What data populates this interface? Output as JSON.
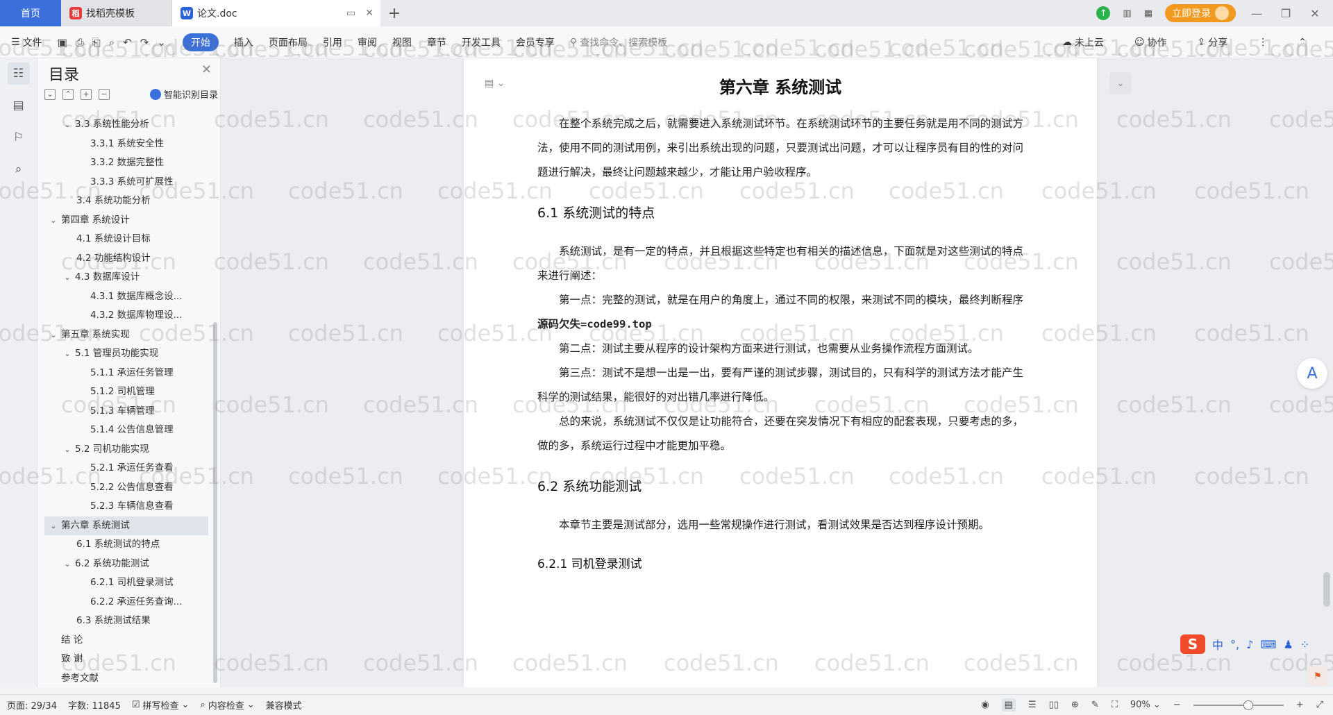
{
  "titlebar": {
    "home_tab": "首页",
    "tabs": [
      {
        "label": "找稻壳模板",
        "icon": "daoke-icon"
      },
      {
        "label": "论文.doc",
        "icon": "wps-writer-icon"
      }
    ],
    "login_label": "立即登录"
  },
  "ribbon": {
    "file_label": "文件",
    "menu": [
      "开始",
      "插入",
      "页面布局",
      "引用",
      "审阅",
      "视图",
      "章节",
      "开发工具",
      "会员专享"
    ],
    "search_placeholder": "查找命令、搜索模板",
    "right": [
      "未上云",
      "协作",
      "分享"
    ]
  },
  "toc": {
    "title": "目录",
    "smart_label": "智能识别目录",
    "items": [
      {
        "label": "3.3 系统性能分析",
        "level": 2,
        "expanded": true
      },
      {
        "label": "3.3.1 系统安全性",
        "level": 3
      },
      {
        "label": "3.3.2 数据完整性",
        "level": 3
      },
      {
        "label": "3.3.3 系统可扩展性",
        "level": 3
      },
      {
        "label": "3.4 系统功能分析",
        "level": 2
      },
      {
        "label": "第四章  系统设计",
        "level": 1,
        "expanded": true
      },
      {
        "label": "4.1  系统设计目标",
        "level": 2
      },
      {
        "label": "4.2 功能结构设计",
        "level": 2
      },
      {
        "label": "4.3 数据库设计",
        "level": 2,
        "expanded": true
      },
      {
        "label": "4.3.1  数据库概念设...",
        "level": 3
      },
      {
        "label": "4.3.2  数据库物理设...",
        "level": 3
      },
      {
        "label": "第五章  系统实现",
        "level": 1,
        "expanded": true
      },
      {
        "label": "5.1 管理员功能实现",
        "level": 2,
        "expanded": true
      },
      {
        "label": "5.1.1  承运任务管理",
        "level": 3
      },
      {
        "label": "5.1.2  司机管理",
        "level": 3
      },
      {
        "label": "5.1.3  车辆管理",
        "level": 3
      },
      {
        "label": "5.1.4  公告信息管理",
        "level": 3
      },
      {
        "label": "5.2 司机功能实现",
        "level": 2,
        "expanded": true
      },
      {
        "label": "5.2.1  承运任务查看",
        "level": 3
      },
      {
        "label": "5.2.2  公告信息查看",
        "level": 3
      },
      {
        "label": "5.2.3  车辆信息查看",
        "level": 3
      },
      {
        "label": "第六章  系统测试",
        "level": 1,
        "expanded": true,
        "active": true
      },
      {
        "label": "6.1 系统测试的特点",
        "level": 2
      },
      {
        "label": "6.2  系统功能测试",
        "level": 2,
        "expanded": true
      },
      {
        "label": "6.2.1  司机登录测试",
        "level": 3
      },
      {
        "label": "6.2.2  承运任务查询...",
        "level": 3
      },
      {
        "label": "6.3  系统测试结果",
        "level": 2
      },
      {
        "label": "结    论",
        "level": 1
      },
      {
        "label": "致    谢",
        "level": 1
      },
      {
        "label": "参考文献",
        "level": 1
      }
    ]
  },
  "document": {
    "chapter_title": "第六章  系统测试",
    "intro": "在整个系统完成之后，就需要进入系统测试环节。在系统测试环节的主要任务就是用不同的测试方法，使用不同的测试用例，来引出系统出现的问题，只要测试出问题，才可以让程序员有目的性的对问题进行解决，最终让问题越来越少，才能让用户验收程序。",
    "s61_title": "6.1 系统测试的特点",
    "s61_p1": "系统测试，是有一定的特点，并且根据这些特定也有相关的描述信息，下面就是对这些测试的特点来进行阐述：",
    "s61_p2_a": "第一点：完整的测试，就是在用户的角度上，通过不同的权限，来测试不同的模块，最终判断程序",
    "s61_p2_overlay": "源码欠失=code99.top",
    "s61_p3": "第二点：测试主要从程序的设计架构方面来进行测试，也需要从业务操作流程方面测试。",
    "s61_p4": "第三点：测试不是想一出是一出，要有严谨的测试步骤，测试目的，只有科学的测试方法才能产生科学的测试结果，能很好的对出错几率进行降低。",
    "s61_p5": "总的来说，系统测试不仅仅是让功能符合，还要在突发情况下有相应的配套表现，只要考虑的多，做的多，系统运行过程中才能更加平稳。",
    "s62_title": "6.2  系统功能测试",
    "s62_p1": "本章节主要是测试部分，选用一些常规操作进行测试，看测试效果是否达到程序设计预期。",
    "s621_title": "6.2.1  司机登录测试"
  },
  "watermark": "code51.cn",
  "ime": {
    "lang": "中",
    "punct": "°,"
  },
  "status": {
    "page": "页面: 29/34",
    "words": "字数: 11845",
    "spell": "拼写检查",
    "content_check": "内容检查",
    "compat": "兼容模式",
    "zoom": "90%",
    "zoom_fraction": 0.9
  }
}
